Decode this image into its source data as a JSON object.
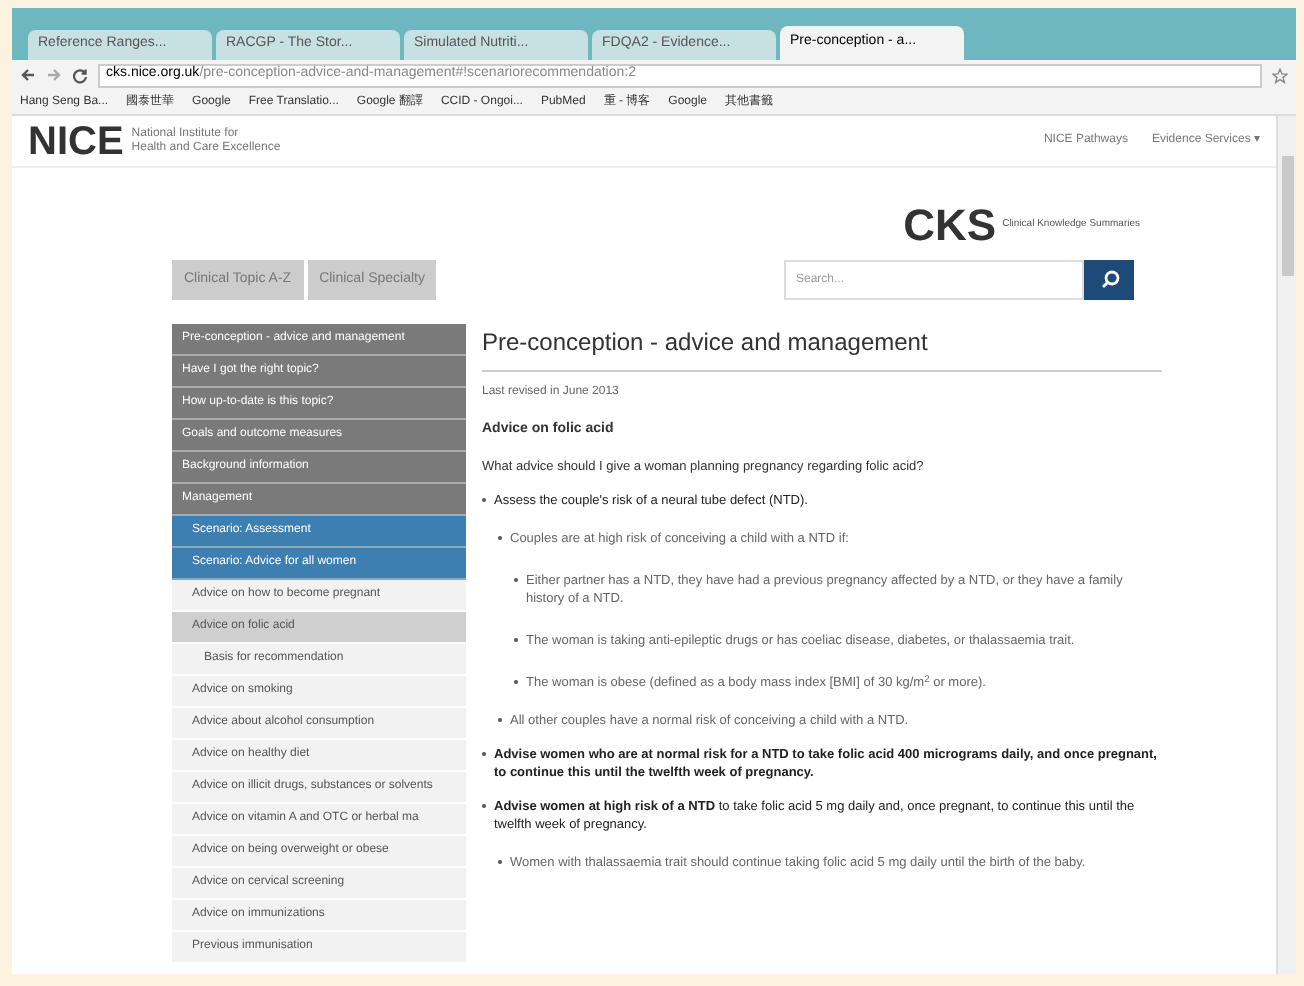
{
  "browser": {
    "tabs": [
      {
        "title": "Reference Ranges...",
        "selected": false
      },
      {
        "title": "RACGP - The Stor...",
        "selected": false
      },
      {
        "title": "Simulated Nutriti...",
        "selected": false
      },
      {
        "title": "FDQA2 - Evidence...",
        "selected": false
      },
      {
        "title": "Pre-conception - a...",
        "selected": true
      }
    ],
    "url_host": "cks.nice.org.uk",
    "url_path": "/pre-conception-advice-and-management#!scenariorecommendation:2",
    "bookmarks": [
      "Hang Seng Ba...",
      "國泰世華",
      "Google",
      "Free Translatio...",
      "Google 翻譯",
      "CCID - Ongoi...",
      "PubMed",
      "重 - 博客",
      "Google",
      "其他書籤"
    ]
  },
  "header": {
    "logo": "NICE",
    "tagline_1": "National Institute for",
    "tagline_2": "Health and Care Excellence",
    "links": [
      "NICE Pathways",
      "Evidence Services ▾"
    ]
  },
  "cks": {
    "logo": "CKS",
    "subtitle": "Clinical Knowledge Summaries"
  },
  "nav_tabs": [
    "Clinical Topic A-Z",
    "Clinical Specialty"
  ],
  "search": {
    "placeholder": "Search..."
  },
  "sidebar": [
    {
      "label": "Pre-conception - advice and management",
      "kind": "dark",
      "selected": false
    },
    {
      "label": "Have I got the right topic?",
      "kind": "dark",
      "selected": false
    },
    {
      "label": "How up-to-date is this topic?",
      "kind": "dark",
      "selected": false
    },
    {
      "label": "Goals and outcome measures",
      "kind": "dark",
      "selected": false
    },
    {
      "label": "Background information",
      "kind": "dark",
      "selected": false
    },
    {
      "label": "Management",
      "kind": "dark",
      "selected": false
    },
    {
      "label": "Scenario: Assessment",
      "kind": "blue",
      "selected": false
    },
    {
      "label": "Scenario: Advice for all women",
      "kind": "blue",
      "selected": false
    },
    {
      "label": "Advice on how to become pregnant",
      "kind": "light",
      "selected": false
    },
    {
      "label": "Advice on folic acid",
      "kind": "light",
      "selected": true
    },
    {
      "label": "Basis for recommendation",
      "kind": "sub",
      "selected": false
    },
    {
      "label": "Advice on smoking",
      "kind": "light",
      "selected": false
    },
    {
      "label": "Advice about alcohol consumption",
      "kind": "light",
      "selected": false
    },
    {
      "label": "Advice on healthy diet",
      "kind": "light",
      "selected": false
    },
    {
      "label": "Advice on illicit drugs, substances or solvents",
      "kind": "light",
      "selected": false
    },
    {
      "label": "Advice on vitamin A and OTC or herbal ma",
      "kind": "light",
      "selected": false
    },
    {
      "label": "Advice on being overweight or obese",
      "kind": "light",
      "selected": false
    },
    {
      "label": "Advice on cervical screening",
      "kind": "light",
      "selected": false
    },
    {
      "label": "Advice on immunizations",
      "kind": "light",
      "selected": false
    },
    {
      "label": "Previous immunisation",
      "kind": "light",
      "selected": false
    }
  ],
  "article": {
    "title": "Pre-conception - advice and management",
    "revised": "Last revised in June 2013",
    "heading": "Advice on folic acid",
    "question": "What advice should I give a woman planning pregnancy regarding folic acid?",
    "list": [
      {
        "text": "Assess the couple's risk of a neural tube defect (NTD).",
        "children": [
          {
            "text": "Couples are at high risk of conceiving a child with a NTD if:",
            "children": [
              {
                "text": "Either partner has a NTD, they have had a previous pregnancy affected by a NTD, or they have a family history of a NTD."
              },
              {
                "text": "The woman is taking anti-epileptic drugs or has coeliac disease, diabetes, or thalassaemia trait."
              },
              {
                "text": "The woman is obese (defined as a body mass index [BMI] of 30 kg/m$^{2}$ or more)."
              }
            ]
          },
          {
            "text": "All other couples have a normal risk of conceiving a child with a NTD."
          }
        ]
      },
      {
        "text": "Advise women who are at normal risk for a NTD to take folic acid 400 micrograms daily, and once pregnant, to continue this until the twelfth week of pregnancy.",
        "bold": true
      },
      {
        "text": "**Advise women at high risk of a NTD** to take folic acid 5 mg daily and, once pregnant, to continue this until the twelfth week of pregnancy.",
        "children": [
          {
            "text": "Women with thalassaemia trait should continue taking folic acid 5 mg daily until the birth of the baby."
          }
        ]
      }
    ]
  }
}
